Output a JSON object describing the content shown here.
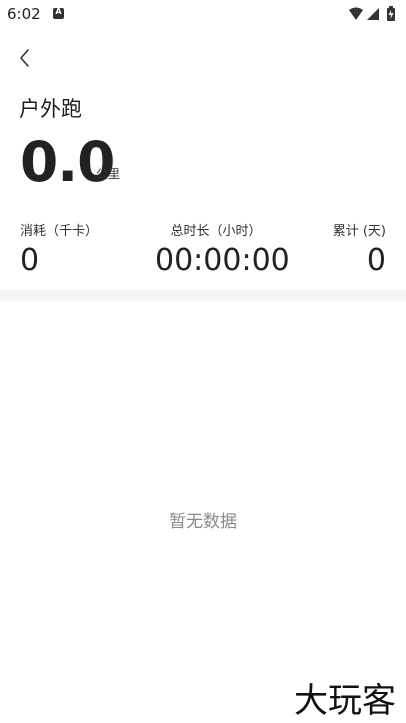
{
  "status_bar": {
    "time": "6:02",
    "notification_icon_letter": "A",
    "icons": [
      "wifi-icon",
      "signal-icon",
      "battery-icon"
    ]
  },
  "header": {
    "back_icon": "chevron-left-icon",
    "title": "户外跑"
  },
  "distance": {
    "value": "0.0",
    "unit": "公里"
  },
  "stats": [
    {
      "label": "消耗（千卡）",
      "value": "0"
    },
    {
      "label": "总时长（小时）",
      "value": "00:00:00"
    },
    {
      "label": "累计 (天)",
      "value": "0"
    }
  ],
  "empty_state": {
    "text": "暂无数据"
  },
  "watermark": {
    "text": "大玩客"
  }
}
